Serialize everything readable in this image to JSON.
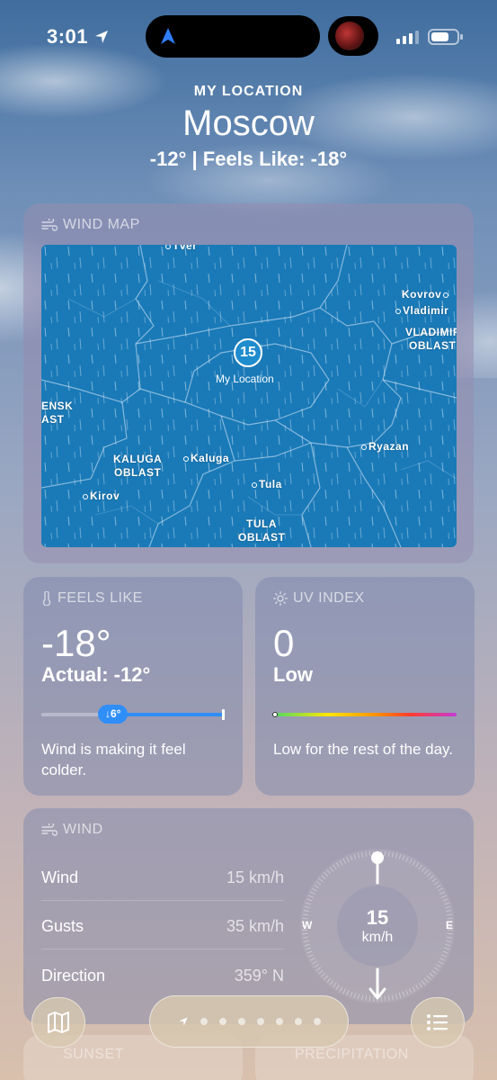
{
  "status_bar": {
    "time": "3:01"
  },
  "header": {
    "location_label": "MY LOCATION",
    "city": "Moscow",
    "temps": "-12°  |  Feels Like: -18°"
  },
  "wind_map": {
    "title": "WIND MAP",
    "my_location_speed": "15",
    "my_location_label": "My Location",
    "places": {
      "tver": "Tver",
      "kovrov": "Kovrov",
      "vladimir": "Vladimir",
      "vladimir_oblast_1": "VLADIMIR",
      "vladimir_oblast_2": "OBLAST",
      "smolensk_1": "ENSK",
      "smolensk_2": "AST",
      "kaluga_oblast_1": "KALUGA",
      "kaluga_oblast_2": "OBLAST",
      "kaluga": "Kaluga",
      "kirov": "Kirov",
      "tula": "Tula",
      "tula_oblast_1": "TULA",
      "tula_oblast_2": "OBLAST",
      "ryazan": "Ryazan"
    }
  },
  "feels_like": {
    "title": "FEELS LIKE",
    "value": "-18°",
    "actual": "Actual: -12°",
    "delta_badge": "↓6°",
    "description": "Wind is making it feel colder."
  },
  "uv_index": {
    "title": "UV INDEX",
    "value": "0",
    "level": "Low",
    "description": "Low for the rest of the day."
  },
  "wind": {
    "title": "WIND",
    "rows": [
      {
        "label": "Wind",
        "value": "15 km/h"
      },
      {
        "label": "Gusts",
        "value": "35 km/h"
      },
      {
        "label": "Direction",
        "value": "359° N"
      }
    ],
    "compass_speed": "15",
    "compass_unit": "km/h",
    "compass_w": "W",
    "compass_e": "E"
  },
  "bottom": {
    "sunset": "SUNSET",
    "precipitation": "PRECIPITATION"
  },
  "colors": {
    "map_water": "#1a7ab8",
    "accent_blue": "#2f8ef7"
  },
  "icons": {
    "map_button": "map-icon",
    "list_button": "list-icon",
    "location_arrow": "location-arrow-icon"
  }
}
